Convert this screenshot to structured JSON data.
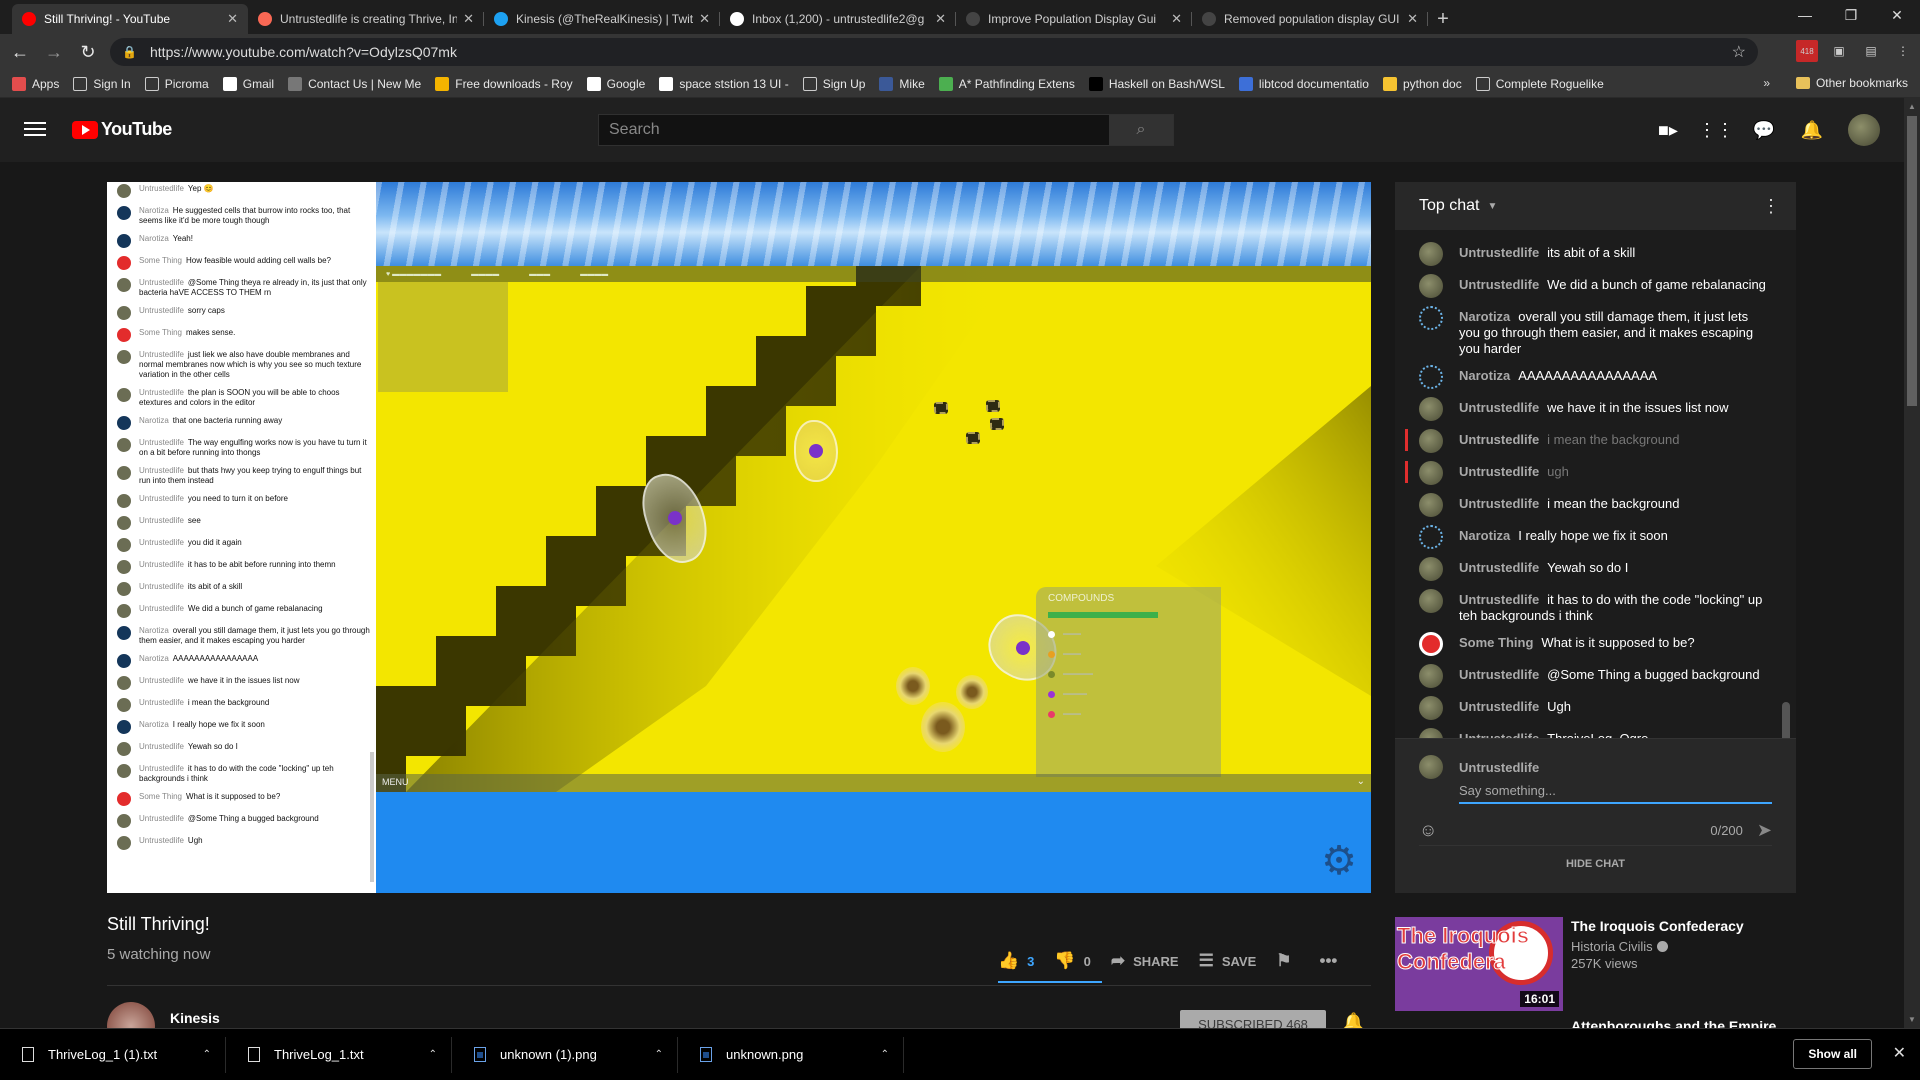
{
  "browser": {
    "tabs": [
      {
        "title": "Still Thriving! - YouTube",
        "icon": "youtube-icon",
        "active": true
      },
      {
        "title": "Untrustedlife is creating Thrive, In",
        "icon": "patreon-icon",
        "active": false
      },
      {
        "title": "Kinesis (@TheRealKinesis) | Twitte",
        "icon": "twitter-icon",
        "active": false
      },
      {
        "title": "Inbox (1,200) - untrustedlife2@g",
        "icon": "gmail-icon",
        "active": false
      },
      {
        "title": "Improve Population Display Gui",
        "icon": "github-icon",
        "active": false
      },
      {
        "title": "Removed population display GUI",
        "icon": "github-icon",
        "active": false
      }
    ],
    "url": "https://www.youtube.com/watch?v=OdylzsQ07mk",
    "extension_badge": "418",
    "bookmarks": [
      {
        "label": "Apps",
        "icon": "apps-grid-icon"
      },
      {
        "label": "Sign In",
        "icon": "page-icon"
      },
      {
        "label": "Picroma",
        "icon": "page-icon"
      },
      {
        "label": "Gmail",
        "icon": "gmail-icon"
      },
      {
        "label": "Contact Us | New Me",
        "icon": "globe-icon"
      },
      {
        "label": "Free downloads - Roy",
        "icon": "download-icon"
      },
      {
        "label": "Google",
        "icon": "google-icon"
      },
      {
        "label": "space ststion 13 UI -",
        "icon": "google-icon"
      },
      {
        "label": "Sign Up",
        "icon": "page-icon"
      },
      {
        "label": "Mike",
        "icon": "facebook-icon"
      },
      {
        "label": "A* Pathfinding Extens",
        "icon": "puzzle-icon"
      },
      {
        "label": "Haskell on Bash/WSL",
        "icon": "medium-icon"
      },
      {
        "label": "libtcod documentatio",
        "icon": "doc-icon"
      },
      {
        "label": "python doc",
        "icon": "python-icon"
      },
      {
        "label": "Complete Roguelike",
        "icon": "page-icon"
      }
    ],
    "bookmarks_more": "»",
    "other_bookmarks": "Other bookmarks"
  },
  "youtube": {
    "logo_text": "YouTube",
    "search_placeholder": "Search"
  },
  "video": {
    "title": "Still Thriving!",
    "watching": "5 watching now",
    "likes": "3",
    "dislikes": "0",
    "share_label": "SHARE",
    "save_label": "SAVE",
    "channel": "Kinesis",
    "subscribe_label": "SUBSCRIBED 468",
    "game_menu": "MENU",
    "compounds_title": "COMPOUNDS",
    "embedded_chat": [
      {
        "author": "Untrustedlife",
        "text": "Yep 😊",
        "av": ""
      },
      {
        "author": "Narotiza",
        "text": "He suggested cells that burrow into rocks too, that seems like it'd be more tough though",
        "av": "blue"
      },
      {
        "author": "Narotiza",
        "text": "Yeah!",
        "av": "blue"
      },
      {
        "author": "Some Thing",
        "text": "How feasible would adding cell walls be?",
        "av": "red"
      },
      {
        "author": "Untrustedlife",
        "text": "@Some Thing theya re already in, its just that only bacteria haVE ACCESS TO THEM rn",
        "av": ""
      },
      {
        "author": "Untrustedlife",
        "text": "sorry caps",
        "av": ""
      },
      {
        "author": "Some Thing",
        "text": "makes sense.",
        "av": "red"
      },
      {
        "author": "Untrustedlife",
        "text": "just liek we also have double membranes and normal membranes now which is why you see so much texture variation in the other cells",
        "av": ""
      },
      {
        "author": "Untrustedlife",
        "text": "the plan is SOON you will be able to choos etextures and colors in the editor",
        "av": ""
      },
      {
        "author": "Narotiza",
        "text": "that one bacteria running away",
        "av": "blue"
      },
      {
        "author": "Untrustedlife",
        "text": "The way engulfing works now is you have tu turn it on a bit before running into thongs",
        "av": ""
      },
      {
        "author": "Untrustedlife",
        "text": "but thats hwy you keep trying to engulf things but run into them instead",
        "av": ""
      },
      {
        "author": "Untrustedlife",
        "text": "you need to turn it on before",
        "av": ""
      },
      {
        "author": "Untrustedlife",
        "text": "see",
        "av": ""
      },
      {
        "author": "Untrustedlife",
        "text": "you did it again",
        "av": ""
      },
      {
        "author": "Untrustedlife",
        "text": "it has to be abit before running into themn",
        "av": ""
      },
      {
        "author": "Untrustedlife",
        "text": "its abit of a skill",
        "av": ""
      },
      {
        "author": "Untrustedlife",
        "text": "We did a bunch of game rebalanacing",
        "av": ""
      },
      {
        "author": "Narotiza",
        "text": "overall you still damage them, it just lets you go through them easier, and it makes escaping you harder",
        "av": "blue"
      },
      {
        "author": "Narotiza",
        "text": "AAAAAAAAAAAAAAAA",
        "av": "blue"
      },
      {
        "author": "Untrustedlife",
        "text": "we have it in the issues list now",
        "av": ""
      },
      {
        "author": "Untrustedlife",
        "text": "i mean the background",
        "av": ""
      },
      {
        "author": "Narotiza",
        "text": "I really hope we fix it soon",
        "av": "blue"
      },
      {
        "author": "Untrustedlife",
        "text": "Yewah so do I",
        "av": ""
      },
      {
        "author": "Untrustedlife",
        "text": "it has to do with the code \"locking\" up teh backgrounds i think",
        "av": ""
      },
      {
        "author": "Some Thing",
        "text": "What is it supposed to be?",
        "av": "red"
      },
      {
        "author": "Untrustedlife",
        "text": "@Some Thing a bugged background",
        "av": ""
      },
      {
        "author": "Untrustedlife",
        "text": "Ugh",
        "av": ""
      }
    ]
  },
  "chat": {
    "header": "Top chat",
    "messages": [
      {
        "author": "Untrustedlife",
        "text": "its abit of a skill",
        "avatar": "user",
        "deleted": false
      },
      {
        "author": "Untrustedlife",
        "text": "We did a bunch of game rebalanacing",
        "avatar": "user",
        "deleted": false
      },
      {
        "author": "Narotiza",
        "text": "overall you still damage them, it just lets you go through them easier, and it makes escaping you harder",
        "avatar": "naro",
        "deleted": false
      },
      {
        "author": "Narotiza",
        "text": "AAAAAAAAAAAAAAAA",
        "avatar": "naro",
        "deleted": false
      },
      {
        "author": "Untrustedlife",
        "text": "we have it in the issues list now",
        "avatar": "user",
        "deleted": false
      },
      {
        "author": "Untrustedlife",
        "text": "i mean the background",
        "avatar": "user",
        "deleted": true
      },
      {
        "author": "Untrustedlife",
        "text": "ugh",
        "avatar": "user",
        "deleted": true
      },
      {
        "author": "Untrustedlife",
        "text": "i mean the background",
        "avatar": "user",
        "deleted": false
      },
      {
        "author": "Narotiza",
        "text": "I really hope we fix it soon",
        "avatar": "naro",
        "deleted": false
      },
      {
        "author": "Untrustedlife",
        "text": "Yewah so do I",
        "avatar": "user",
        "deleted": false
      },
      {
        "author": "Untrustedlife",
        "text": "it has to do with the code \"locking\" up teh backgrounds i think",
        "avatar": "user",
        "deleted": false
      },
      {
        "author": "Some Thing",
        "text": "What is it supposed to be?",
        "avatar": "some",
        "deleted": false
      },
      {
        "author": "Untrustedlife",
        "text": "@Some Thing a bugged background",
        "avatar": "user",
        "deleted": false
      },
      {
        "author": "Untrustedlife",
        "text": "Ugh",
        "avatar": "user",
        "deleted": false
      },
      {
        "author": "Untrustedlife",
        "text": "ThroiveLog_Ogre",
        "avatar": "user",
        "deleted": false
      }
    ],
    "composer_user": "Untrustedlife",
    "composer_placeholder": "Say something...",
    "char_count": "0/200",
    "hide_label": "HIDE CHAT"
  },
  "recommendation": {
    "title": "The Iroquois Confederacy",
    "channel": "Historia Civilis",
    "views": "257K views",
    "duration": "16:01",
    "thumb_text": "The Iroquois Confedera",
    "next_title": "Attenboroughs and the Empire"
  },
  "downloads": [
    {
      "name": "ThriveLog_1 (1).txt",
      "type": "text"
    },
    {
      "name": "ThriveLog_1.txt",
      "type": "text"
    },
    {
      "name": "unknown (1).png",
      "type": "image"
    },
    {
      "name": "unknown.png",
      "type": "image"
    }
  ],
  "show_all_label": "Show all",
  "colors": {
    "accent_blue": "#3ea6ff",
    "youtube_red": "#ff0000",
    "game_yellow": "#f3e600",
    "deleted_marker": "#e02e2e"
  }
}
